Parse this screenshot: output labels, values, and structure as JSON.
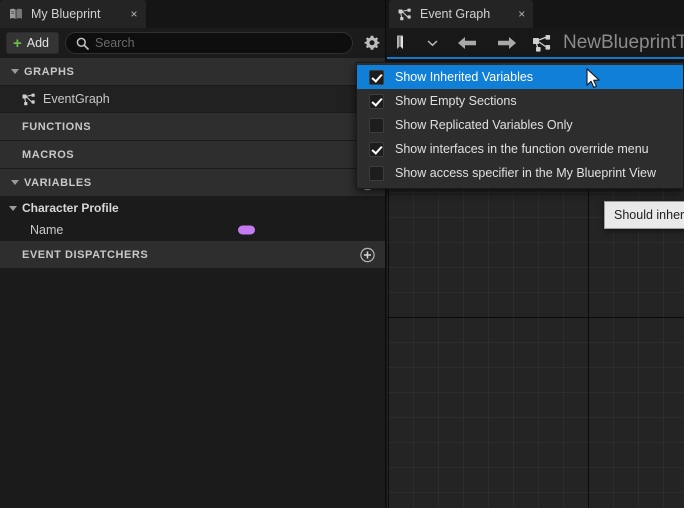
{
  "left_panel": {
    "tab": {
      "label": "My Blueprint",
      "icon": "blueprint-book-icon",
      "close": "×"
    },
    "toolbar": {
      "add_label": "Add",
      "add_plus": "+",
      "search_placeholder": "Search",
      "search_value": "",
      "search_icon": "search-icon",
      "settings_icon": "gear-icon"
    },
    "sections": [
      {
        "label": "GRAPHS",
        "expandable": true,
        "has_add": false
      },
      {
        "label": "FUNCTIONS",
        "expandable": false,
        "has_add": false
      },
      {
        "label": "MACROS",
        "expandable": false,
        "has_add": false
      },
      {
        "label": "VARIABLES",
        "expandable": true,
        "has_add": true
      },
      {
        "label": "EVENT DISPATCHERS",
        "expandable": false,
        "has_add": true
      }
    ],
    "graph_item": {
      "label": "EventGraph",
      "icon": "event-graph-icon"
    },
    "variable_category": "Character Profile",
    "variables": [
      {
        "name": "Name",
        "pin_color": "#c47bf0",
        "pin_type": "name"
      }
    ]
  },
  "graph_panel": {
    "tab": {
      "label": "Event Graph",
      "icon": "event-graph-icon",
      "close": "×"
    },
    "toolbar": {
      "bookmark_icon": "bookmark-icon",
      "bookmark_chevron": "chevron-down-icon",
      "back_icon": "arrow-left-icon",
      "forward_icon": "arrow-right-icon",
      "graph_icon": "event-graph-icon",
      "title": "NewBlueprintT"
    }
  },
  "menu": {
    "items": [
      {
        "label": "Show Inherited Variables",
        "checked": true,
        "selected": true
      },
      {
        "label": "Show Empty Sections",
        "checked": true,
        "selected": false
      },
      {
        "label": "Show Replicated Variables Only",
        "checked": false,
        "selected": false
      },
      {
        "label": "Show interfaces in the function override menu",
        "checked": true,
        "selected": false
      },
      {
        "label": "Show access specifier in the My Blueprint View",
        "checked": false,
        "selected": false
      }
    ]
  },
  "tooltip": {
    "text": "Should inheri"
  },
  "colors": {
    "accent_blue": "#0f7fd8",
    "add_green": "#6cc04a",
    "name_pin": "#c47bf0"
  }
}
